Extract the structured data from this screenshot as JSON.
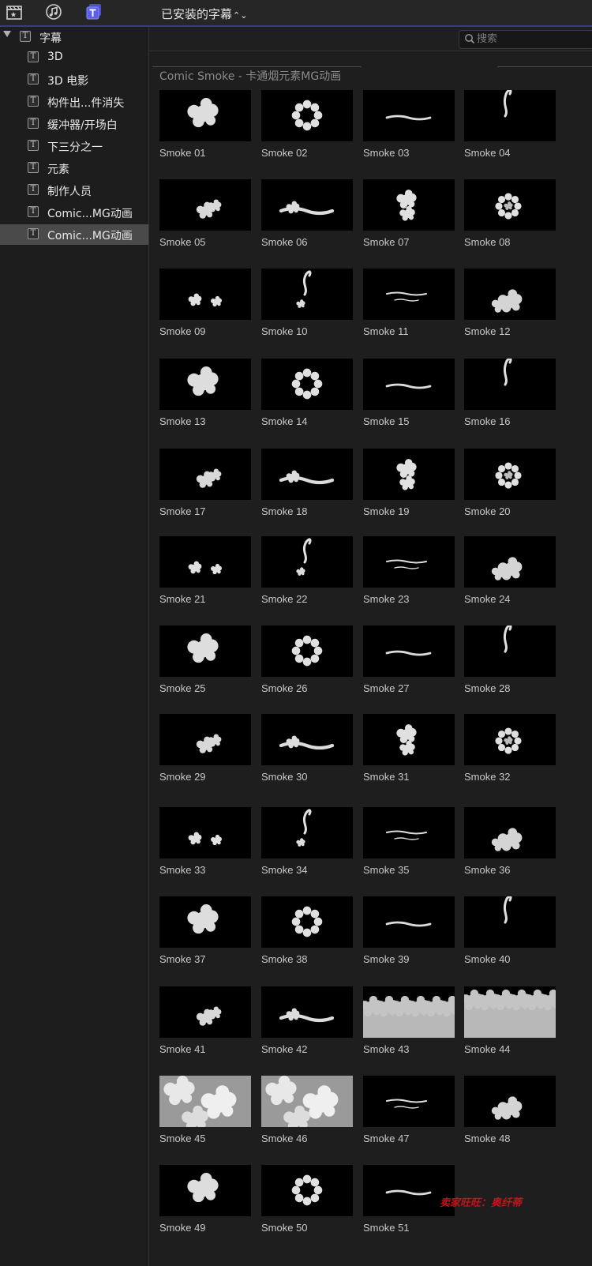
{
  "toolbar": {
    "title": "已安装的字幕",
    "title_chevron": "⌃⌄",
    "icons": [
      "clapper-icon",
      "music-icon",
      "titles-icon"
    ],
    "active_icon": "titles-icon",
    "accent_color": "#5a5ef0"
  },
  "sidebar": {
    "root": {
      "label": "字幕",
      "expanded": true,
      "icon": "T"
    },
    "items": [
      {
        "label": "3D",
        "icon": "T"
      },
      {
        "label": "3D 电影",
        "icon": "T"
      },
      {
        "label": "构件出...件消失",
        "icon": "T"
      },
      {
        "label": "缓冲器/开场白",
        "icon": "T"
      },
      {
        "label": "下三分之一",
        "icon": "T"
      },
      {
        "label": "元素",
        "icon": "T"
      },
      {
        "label": "制作人员",
        "icon": "T"
      },
      {
        "label": "Comic...MG动画",
        "icon": "T"
      },
      {
        "label": "Comic...MG动画",
        "icon": "T",
        "selected": true
      }
    ]
  },
  "search": {
    "placeholder": "搜索",
    "value": ""
  },
  "group": {
    "title": "Comic Smoke - 卡通烟元素MG动画"
  },
  "tiles": [
    "Smoke 01",
    "Smoke 02",
    "Smoke 03",
    "Smoke 04",
    "Smoke 05",
    "Smoke 06",
    "Smoke 07",
    "Smoke 08",
    "Smoke 09",
    "Smoke 10",
    "Smoke 11",
    "Smoke 12",
    "Smoke 13",
    "Smoke 14",
    "Smoke 15",
    "Smoke 16",
    "Smoke 17",
    "Smoke 18",
    "Smoke 19",
    "Smoke 20",
    "Smoke 21",
    "Smoke 22",
    "Smoke 23",
    "Smoke 24",
    "Smoke 25",
    "Smoke 26",
    "Smoke 27",
    "Smoke 28",
    "Smoke 29",
    "Smoke 30",
    "Smoke 31",
    "Smoke 32",
    "Smoke 33",
    "Smoke 34",
    "Smoke 35",
    "Smoke 36",
    "Smoke 37",
    "Smoke 38",
    "Smoke 39",
    "Smoke 40",
    "Smoke 41",
    "Smoke 42",
    "Smoke 43",
    "Smoke 44",
    "Smoke 45",
    "Smoke 46",
    "Smoke 47",
    "Smoke 48",
    "Smoke 49",
    "Smoke 50",
    "Smoke 51"
  ],
  "watermark": "卖家旺旺：奥纤蒂"
}
